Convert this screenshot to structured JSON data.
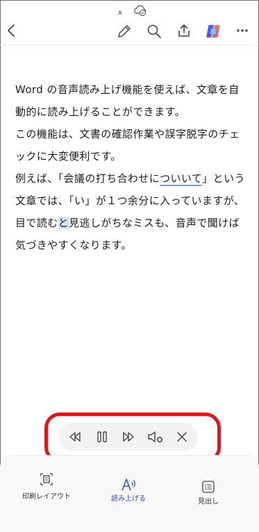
{
  "header": {
    "doc_marker": "x",
    "icons": [
      "cloud-sync-icon",
      "back-icon",
      "edit-pen-icon",
      "search-icon",
      "share-icon",
      "copilot-icon",
      "more-icon"
    ]
  },
  "document": {
    "line1": "Word の音声読み上げ機能を使えば、文章を自動的に読み上げることができます。",
    "line2": "この機能は、文書の確認作業や誤字脱字のチェックに大変便利です。",
    "line3_a": "例えば、「会議の打ち合わせに",
    "line3_b": "ついいて",
    "line3_c": "」という文章では、「い」が１つ余分に入っていますが、目で読む",
    "line3_d": "と",
    "line3_e": "見逃しがちなミスも、音声で聞けば気づきやすくなります。"
  },
  "player": {
    "controls": [
      "rewind-icon",
      "pause-icon",
      "fast-forward-icon",
      "voice-settings-icon",
      "close-icon"
    ]
  },
  "bottom_bar": {
    "print_layout": "印刷レイアウト",
    "read_aloud": "読み上げる",
    "headings": "見出し"
  },
  "colors": {
    "accent": "#2b4cc7",
    "annotation": "#e3141b",
    "underline": "#7c9fd8",
    "selection": "#d4e2f4"
  }
}
